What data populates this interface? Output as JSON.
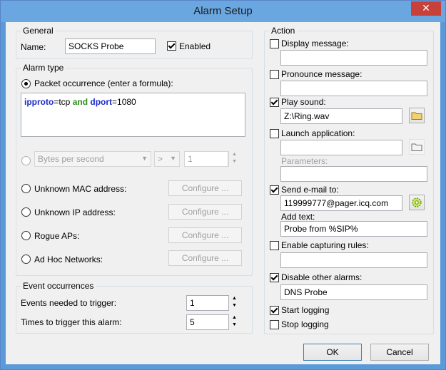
{
  "window": {
    "title": "Alarm Setup",
    "close_glyph": "✕"
  },
  "general": {
    "legend": "General",
    "name_label": "Name:",
    "name_value": "SOCKS Probe",
    "enabled_label": "Enabled",
    "enabled_checked": true
  },
  "alarm_type": {
    "legend": "Alarm type",
    "packet_label": "Packet occurrence (enter a formula):",
    "formula": {
      "k1": "ipproto",
      "t1": "=tcp ",
      "k2": "and",
      "t2": " ",
      "k3": "dport",
      "t3": "=1080"
    },
    "bytes_select": "Bytes per second",
    "op_select": ">",
    "bytes_value": "1",
    "unknown_mac": "Unknown MAC address:",
    "unknown_ip": "Unknown IP address:",
    "rogue_aps": "Rogue APs:",
    "adhoc": "Ad Hoc Networks:",
    "configure": "Configure ..."
  },
  "events": {
    "legend": "Event occurrences",
    "needed_label": "Events needed to trigger:",
    "needed_value": "1",
    "times_label": "Times to trigger this alarm:",
    "times_value": "5"
  },
  "action": {
    "legend": "Action",
    "display_message": "Display message:",
    "pronounce_message": "Pronounce message:",
    "play_sound": "Play sound:",
    "sound_file": "Z:\\Ring.wav",
    "launch_app": "Launch application:",
    "parameters": "Parameters:",
    "send_email": "Send e-mail to:",
    "email_to": "119999777@pager.icq.com",
    "add_text": "Add text:",
    "email_text": "Probe from %SIP%",
    "enable_capturing": "Enable capturing rules:",
    "disable_alarms": "Disable other alarms:",
    "disable_alarms_value": "DNS Probe",
    "start_logging": "Start logging",
    "stop_logging": "Stop logging"
  },
  "buttons": {
    "ok": "OK",
    "cancel": "Cancel"
  },
  "colors": {
    "titlebar": "#6aa6e0",
    "keyword_blue": "#1c2bc8",
    "keyword_green": "#2c8c1c"
  }
}
